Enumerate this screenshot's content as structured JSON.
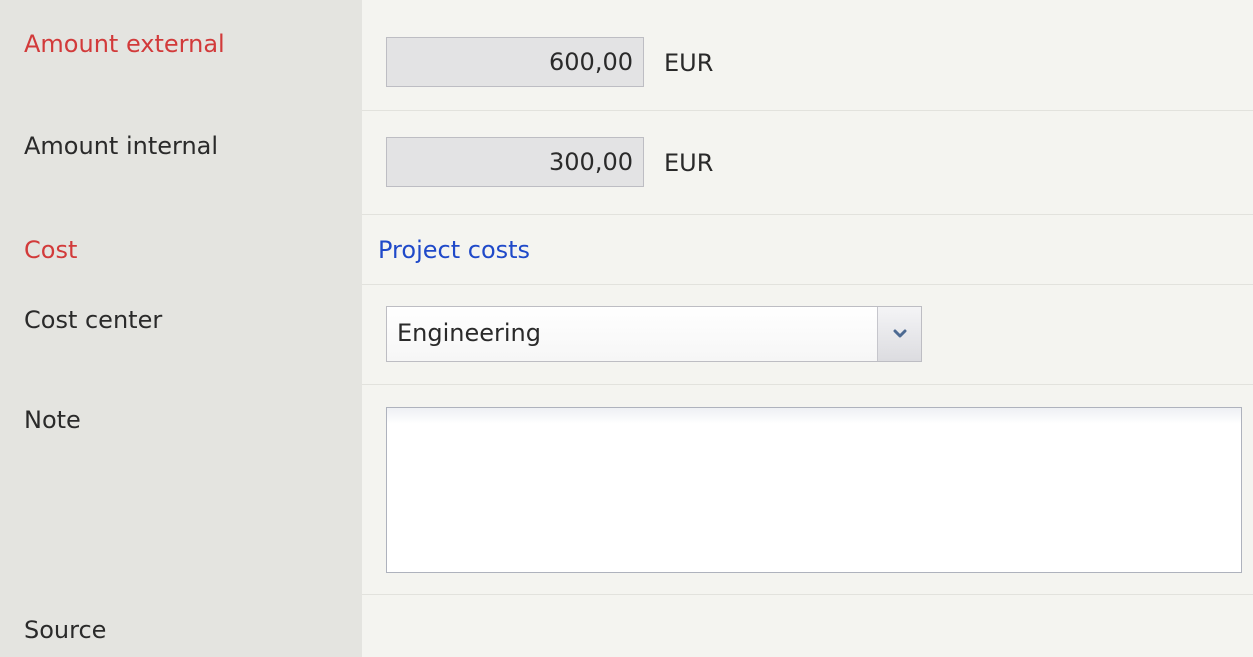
{
  "form": {
    "amount_external": {
      "label": "Amount external",
      "value": "600,00",
      "currency": "EUR"
    },
    "amount_internal": {
      "label": "Amount internal",
      "value": "300,00",
      "currency": "EUR"
    },
    "cost": {
      "label": "Cost",
      "link_text": "Project costs"
    },
    "cost_center": {
      "label": "Cost center",
      "selected": "Engineering"
    },
    "note": {
      "label": "Note",
      "value": ""
    },
    "source": {
      "label": "Source"
    }
  },
  "colors": {
    "required_label": "#d23a3a",
    "link": "#1f49c9",
    "label_column_bg": "#e4e4e0",
    "content_bg": "#f4f4f0"
  },
  "icons": {
    "dropdown": "chevron-down-icon"
  }
}
